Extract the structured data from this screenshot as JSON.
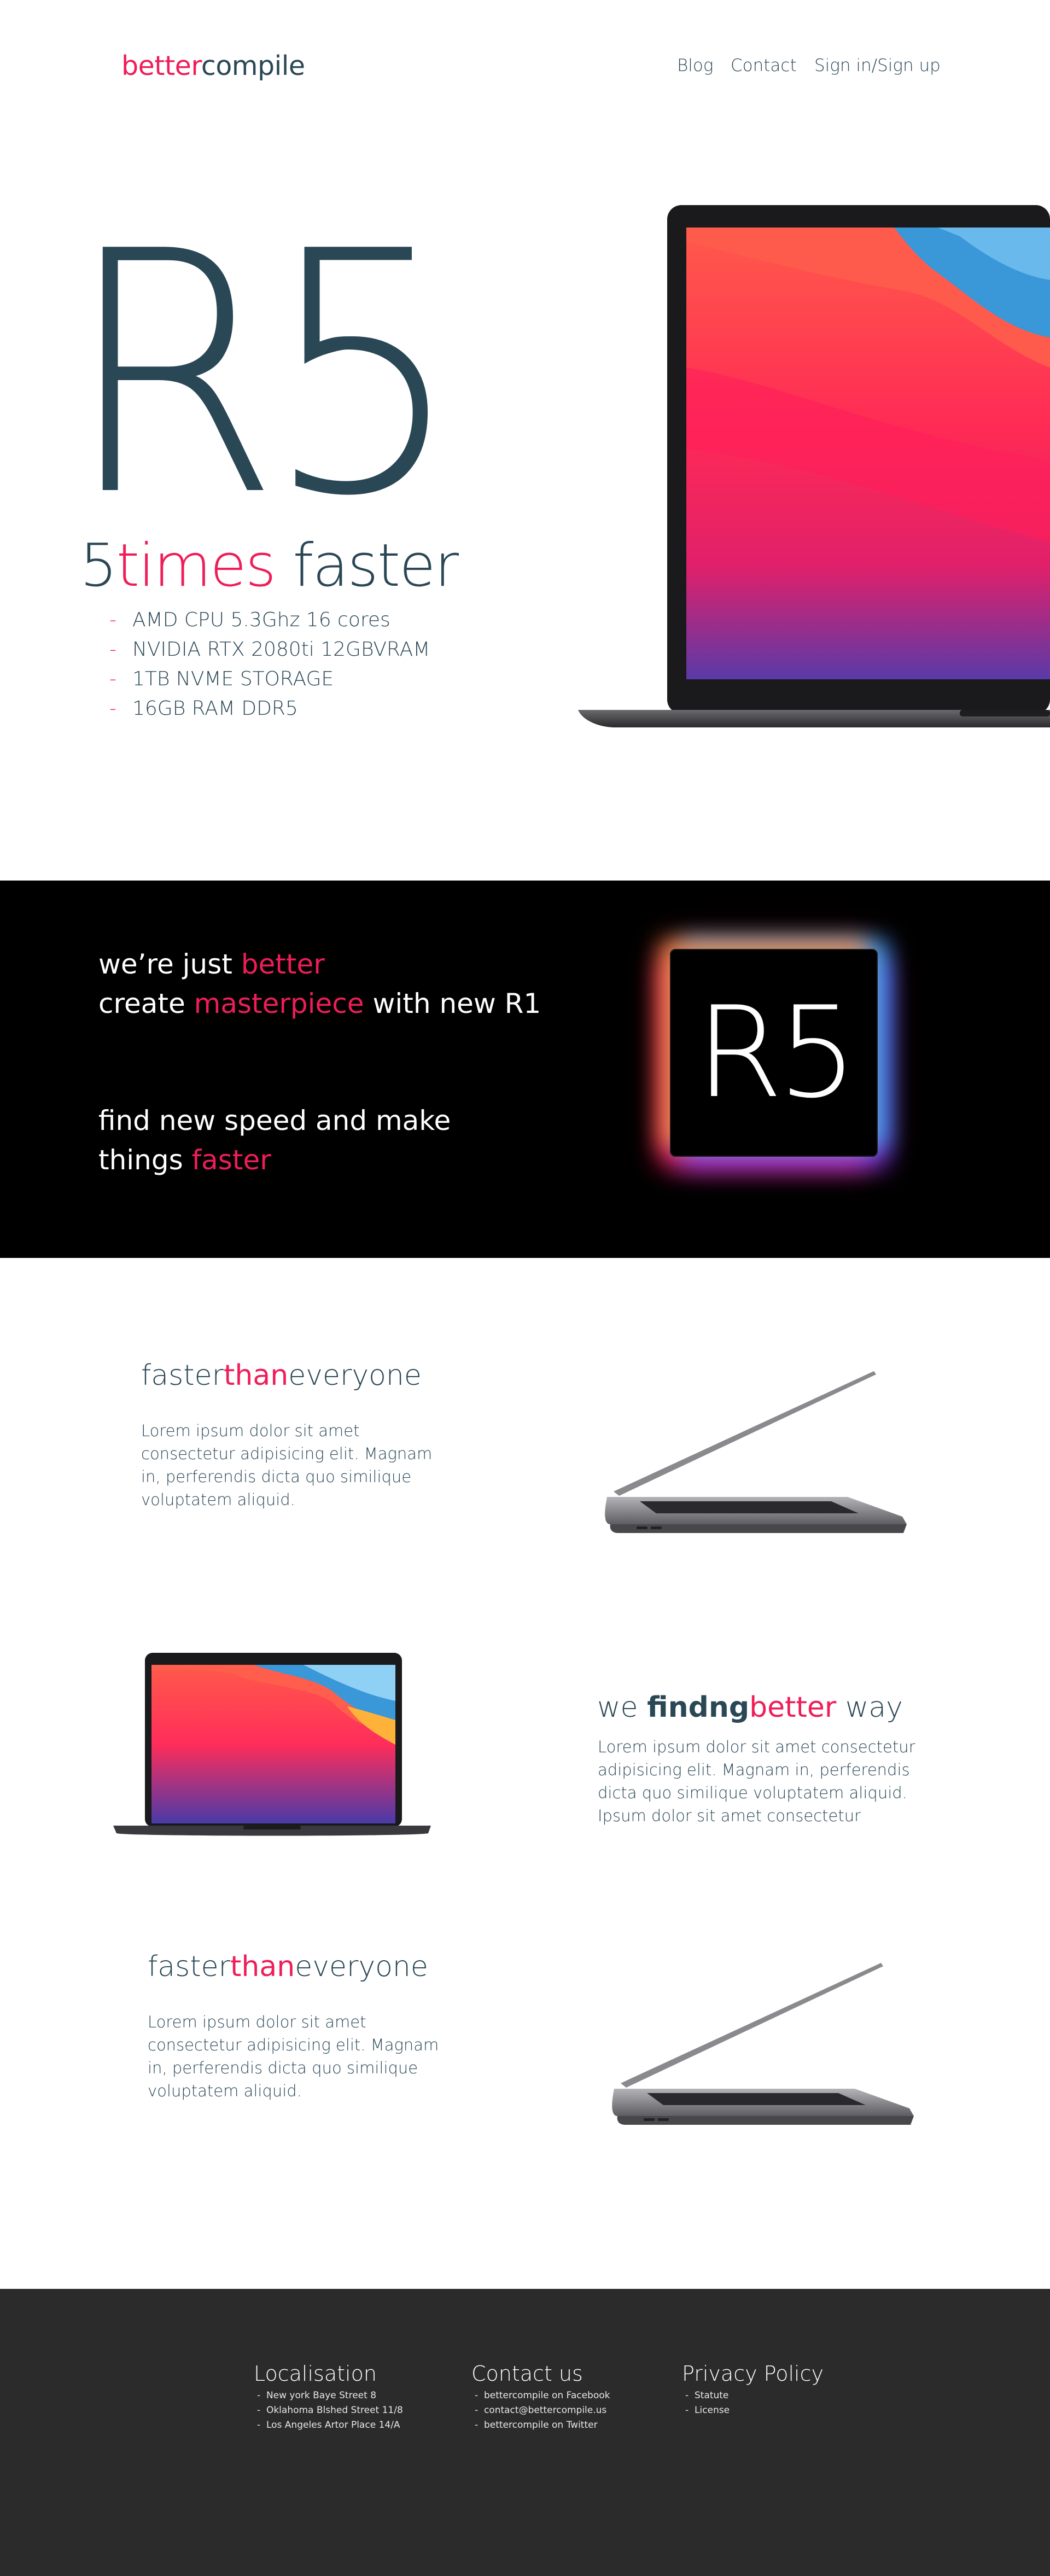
{
  "header": {
    "logo_strong": "better",
    "logo_rest": "compile",
    "nav": [
      "Blog",
      "Contact",
      "Sign in/Sign up"
    ]
  },
  "hero": {
    "big_text": "R5",
    "sub_number": "5",
    "sub_accent": "times",
    "sub_rest": " faster",
    "specs": [
      "AMD CPU 5.3Ghz 16 cores",
      "NVIDIA RTX 2080ti 12GBVRAM",
      "1TB NVME STORAGE",
      "16GB RAM DDR5"
    ],
    "spec_marker": "-"
  },
  "band": {
    "line1_start": "we’re just ",
    "line1_accent": "better",
    "line2_start": "create ",
    "line2_accent": "masterpiece",
    "line2_end": " with new R1",
    "line3": "find new speed and make",
    "line4_start": "things ",
    "line4_accent": "faster",
    "chip_label": "R5"
  },
  "features": [
    {
      "title_a": "faster",
      "title_b": "than",
      "title_c": "everyone",
      "body": "Lorem ipsum dolor sit amet consectetur adipisicing elit. Magnam in, perferendis dicta quo similique voluptatem aliquid."
    },
    {
      "title_a": "we ",
      "title_b": "findng",
      "title_c": "better",
      "title_d": " way",
      "body": "Lorem ipsum dolor sit amet consectetur adipisicing elit. Magnam in, perferendis dicta quo similique voluptatem aliquid. Ipsum dolor sit amet consectetur"
    },
    {
      "title_a": "faster",
      "title_b": "than",
      "title_c": "everyone",
      "body": "Lorem ipsum dolor sit amet consectetur adipisicing elit. Magnam in, perferendis dicta quo similique voluptatem aliquid."
    }
  ],
  "footer": {
    "columns": [
      {
        "title": "Localisation",
        "items": [
          "New york Baye Street 8",
          "Oklahoma Blshed Street 11/8",
          "Los Angeles Artor Place 14/A"
        ]
      },
      {
        "title": "Contact us",
        "items": [
          "bettercompile on Facebook",
          "contact@bettercompile.us",
          "bettercompile on Twitter"
        ]
      },
      {
        "title": "Privacy Policy",
        "items": [
          "Statute",
          "License"
        ]
      }
    ],
    "item_marker": "-"
  },
  "colors": {
    "accent": "#ef1d58",
    "text": "#2a4756",
    "band_bg": "#000000",
    "footer_bg": "#2b2b2b"
  }
}
